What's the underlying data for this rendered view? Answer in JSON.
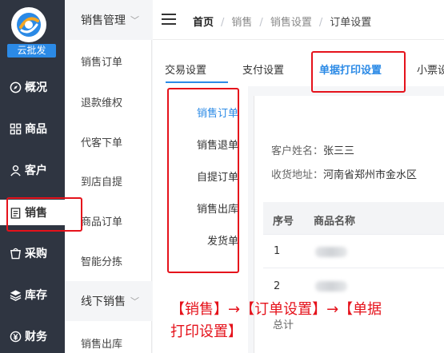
{
  "nav": {
    "brand": "云批发",
    "items": [
      {
        "label": "概况",
        "icon": "compass-icon"
      },
      {
        "label": "商品",
        "icon": "grid-icon"
      },
      {
        "label": "客户",
        "icon": "user-icon"
      },
      {
        "label": "销售",
        "icon": "clipboard-icon",
        "active": true
      },
      {
        "label": "采购",
        "icon": "bag-icon"
      },
      {
        "label": "库存",
        "icon": "layers-icon"
      },
      {
        "label": "财务",
        "icon": "yen-icon"
      }
    ]
  },
  "subnav": {
    "sections": [
      {
        "title": "销售管理",
        "items": [
          "销售订单",
          "退款维权",
          "代客下单",
          "到店自提",
          "商品订单",
          "智能分拣"
        ]
      },
      {
        "title": "线下销售",
        "items": [
          "销售出库"
        ]
      }
    ]
  },
  "breadcrumb": [
    "首页",
    "销售",
    "销售设置",
    "订单设置"
  ],
  "tabs": [
    {
      "label": "交易设置"
    },
    {
      "label": "支付设置"
    },
    {
      "label": "单据打印设置",
      "active": true
    },
    {
      "label": "小票设"
    }
  ],
  "print_types": [
    "销售订单",
    "销售退单",
    "自提订单",
    "销售出库",
    "发货单"
  ],
  "preview": {
    "customer_label": "客户姓名：",
    "customer_value": "张三三",
    "address_label": "收货地址：",
    "address_value": "河南省郑州市金水区",
    "columns": [
      "序号",
      "商品名称"
    ],
    "rows": [
      "1",
      "2"
    ],
    "total_label": "总计"
  },
  "annotation": {
    "line1": "【销售】→【订单设置】→【单据",
    "line2": "打印设置】",
    "color": "#e5121b"
  },
  "colors": {
    "accent": "#2b8ae6",
    "nav_bg": "#2f3541"
  }
}
